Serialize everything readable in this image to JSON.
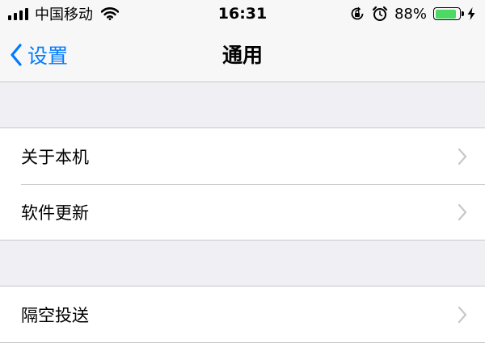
{
  "status_bar": {
    "carrier": "中国移动",
    "time": "16:31",
    "battery_percent": "88%",
    "battery_level": 0.88,
    "icons": [
      "signal-icon",
      "wifi-icon",
      "orientation-lock-icon",
      "alarm-icon",
      "battery-icon",
      "charging-icon"
    ]
  },
  "nav": {
    "back_label": "设置",
    "title": "通用"
  },
  "sections": [
    {
      "items": [
        {
          "label": "关于本机"
        },
        {
          "label": "软件更新"
        }
      ]
    },
    {
      "items": [
        {
          "label": "隔空投送"
        }
      ]
    }
  ],
  "colors": {
    "accent": "#007aff",
    "background": "#efeff4",
    "battery": "#4cd964",
    "separator": "#c8c7cc",
    "chevron": "#c7c7cc"
  }
}
